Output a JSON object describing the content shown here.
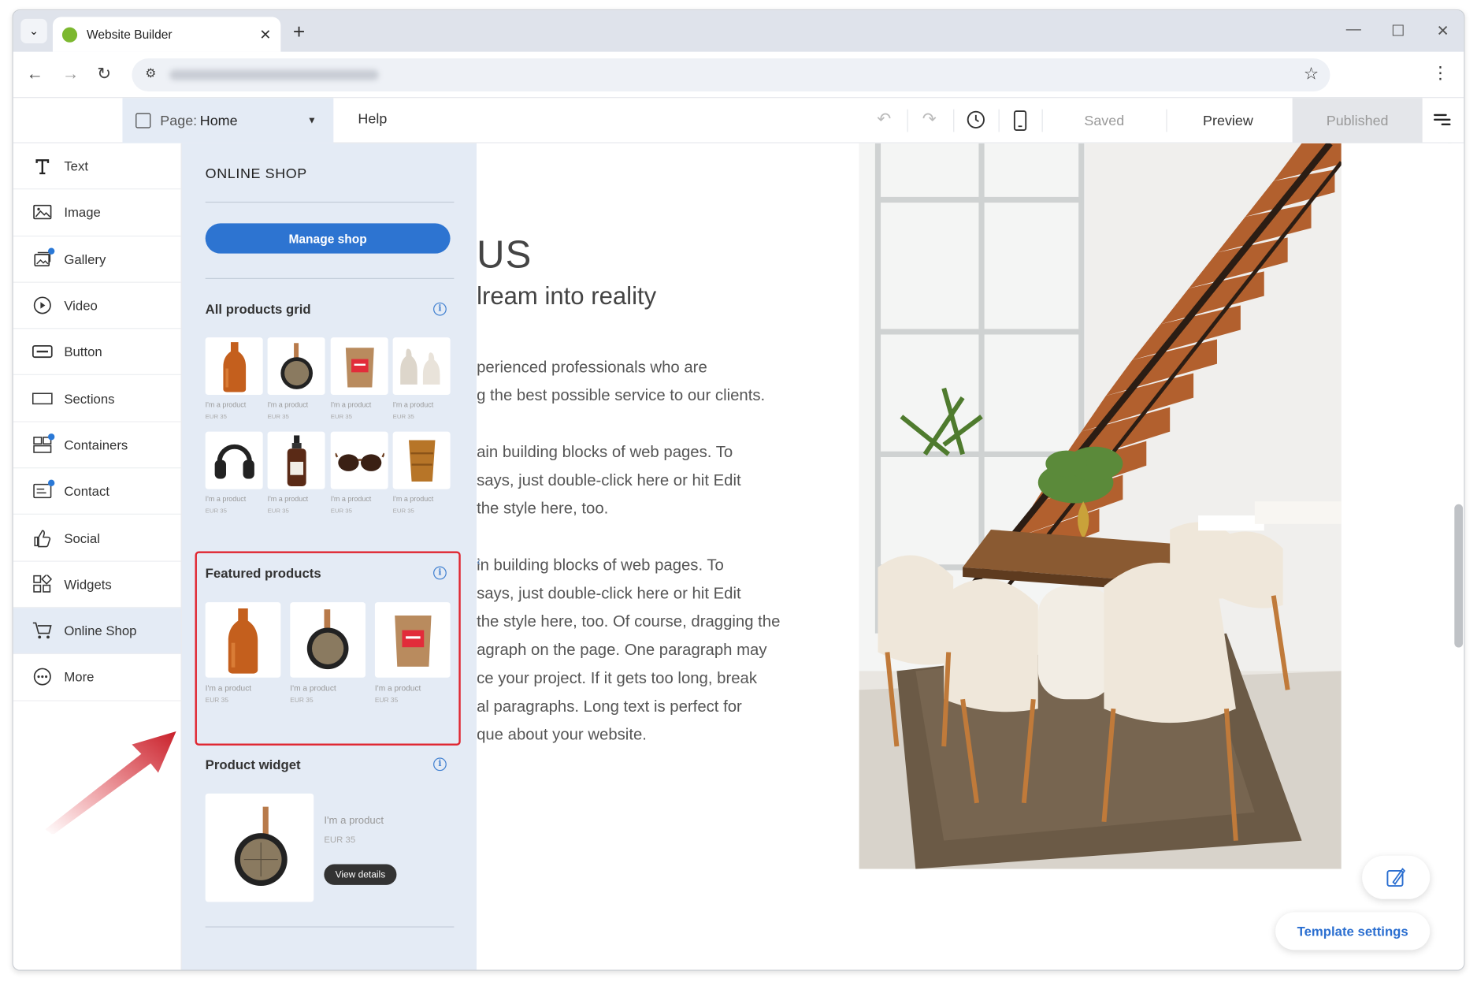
{
  "browser": {
    "tab_title": "Website Builder",
    "close_glyph": "✕",
    "newtab_glyph": "+"
  },
  "editor": {
    "page_label": "Page:",
    "page_value": "Home",
    "help": "Help",
    "saved": "Saved",
    "preview": "Preview",
    "published": "Published"
  },
  "rail": {
    "items": [
      {
        "label": "Text",
        "icon": "text-icon"
      },
      {
        "label": "Image",
        "icon": "image-icon"
      },
      {
        "label": "Gallery",
        "icon": "gallery-icon"
      },
      {
        "label": "Video",
        "icon": "video-icon"
      },
      {
        "label": "Button",
        "icon": "button-icon"
      },
      {
        "label": "Sections",
        "icon": "sections-icon"
      },
      {
        "label": "Containers",
        "icon": "containers-icon"
      },
      {
        "label": "Contact",
        "icon": "contact-icon"
      },
      {
        "label": "Social",
        "icon": "thumbs-up-icon"
      },
      {
        "label": "Widgets",
        "icon": "widgets-icon"
      },
      {
        "label": "Online Shop",
        "icon": "cart-icon"
      },
      {
        "label": "More",
        "icon": "more-icon"
      }
    ]
  },
  "panel": {
    "title": "ONLINE SHOP",
    "manage": "Manage shop",
    "all_products": {
      "title": "All products grid",
      "products": [
        {
          "name": "I'm a product",
          "price": "EUR 35"
        },
        {
          "name": "I'm a product",
          "price": "EUR 35"
        },
        {
          "name": "I'm a product",
          "price": "EUR 35"
        },
        {
          "name": "I'm a product",
          "price": "EUR 35"
        },
        {
          "name": "I'm a product",
          "price": "EUR 35"
        },
        {
          "name": "I'm a product",
          "price": "EUR 35"
        },
        {
          "name": "I'm a product",
          "price": "EUR 35"
        },
        {
          "name": "I'm a product",
          "price": "EUR 35"
        }
      ]
    },
    "featured": {
      "title": "Featured products",
      "products": [
        {
          "name": "I'm a product",
          "price": "EUR 35"
        },
        {
          "name": "I'm a product",
          "price": "EUR 35"
        },
        {
          "name": "I'm a product",
          "price": "EUR 35"
        }
      ]
    },
    "widget": {
      "title": "Product widget",
      "name": "I'm a product",
      "price": "EUR 35",
      "button": "View details"
    }
  },
  "page": {
    "heading": "US",
    "subheading": "lream into reality",
    "para1": [
      "perienced professionals who are",
      "g the best possible service to our clients."
    ],
    "para2": [
      "ain building blocks of web pages. To",
      "says, just double-click here or hit Edit",
      "the style here, too."
    ],
    "para3": [
      "in building blocks of web pages. To",
      "says, just double-click here or hit Edit",
      "the style here, too. Of course, dragging the",
      "agraph on the page. One paragraph may",
      "ce your project. If it gets too long, break",
      "al paragraphs. Long text is perfect for",
      "que about your website."
    ]
  },
  "floating": {
    "template_settings": "Template settings"
  },
  "colors": {
    "accent": "#2d74d1",
    "highlight": "#e0242f",
    "panel_bg": "#e4ebf5"
  }
}
